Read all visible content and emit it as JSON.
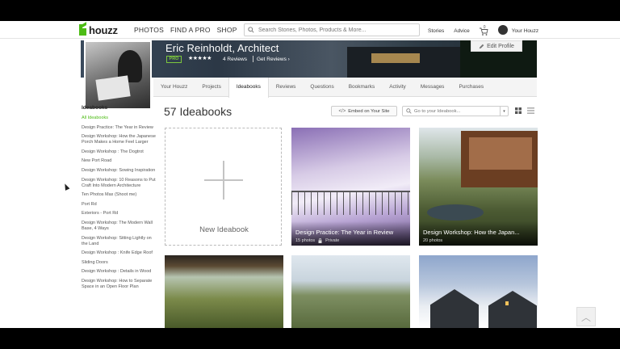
{
  "topnav": {
    "logo_text": "houzz",
    "links": [
      "PHOTOS",
      "FIND A PRO",
      "SHOP"
    ],
    "search_placeholder": "Search Stories, Photos, Products & More...",
    "right_links": [
      "Stories",
      "Advice"
    ],
    "cart_count": "0",
    "user_label": "Your Houzz"
  },
  "profile": {
    "name": "Eric Reinholdt, Architect",
    "badge": "PRO",
    "stars": "★★★★★",
    "reviews": "4 Reviews",
    "get_reviews": "Get Reviews ›",
    "edit_label": "Edit Profile"
  },
  "tabs": [
    {
      "label": "Your Houzz"
    },
    {
      "label": "Projects"
    },
    {
      "label": "Ideabooks"
    },
    {
      "label": "Reviews"
    },
    {
      "label": "Questions"
    },
    {
      "label": "Bookmarks"
    },
    {
      "label": "Activity"
    },
    {
      "label": "Messages"
    },
    {
      "label": "Purchases"
    }
  ],
  "active_tab": "Ideabooks",
  "sidebar": {
    "heading": "Ideabooks",
    "items": [
      "All Ideabooks",
      "Design Practice: The Year in Review",
      "Design Workshop: How the Japanese Porch Makes a Home Feel Larger",
      "Design Workshop : The Dogtrot",
      "New Port Road",
      "Design Workshop: Sowing Inspiration",
      "Design Workshop: 10 Reasons to Put Craft Into Modern Architecture",
      "Ten Photos Max (Shoot me)",
      "Port Rd",
      "Exteriors - Port Rd",
      "Design Workshop: The Modern Wall Base, 4 Ways",
      "Design Workshop: Sitting Lightly on the Land",
      "Design Workshop : Knife Edge Roof",
      "Sliding Doors",
      "Design Workshop : Details in Wood",
      "Design Workshop: How to Separate Space in an Open Floor Plan"
    ]
  },
  "main": {
    "title": "57 Ideabooks",
    "embed_label": "Embed on Your Site",
    "goto_placeholder": "Go to your Ideabook...",
    "new_label": "New Ideabook",
    "cards": [
      {
        "title": "Design Practice: The Year in Review",
        "photos": "15 photos",
        "privacy": "Private"
      },
      {
        "title": "Design Workshop: How the Japan...",
        "photos": "20 photos",
        "privacy": ""
      }
    ]
  },
  "colors": {
    "brand_green": "#4dbc15"
  }
}
